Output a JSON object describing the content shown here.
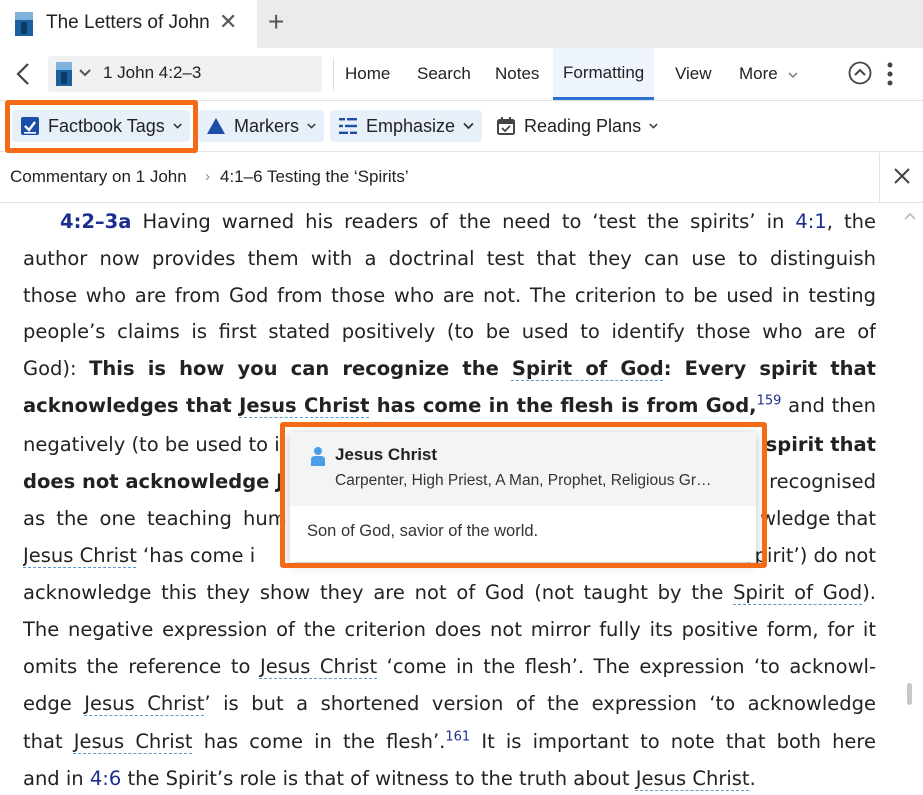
{
  "tab": {
    "title": "The Letters of John",
    "close": "✕",
    "add": "+"
  },
  "nav": {
    "reference": "1 John 4:2–3",
    "menu": [
      "Home",
      "Search",
      "Notes",
      "Formatting",
      "View",
      "More"
    ],
    "active_menu": "Formatting"
  },
  "ribbon": {
    "factbook_tags": "Factbook Tags",
    "markers": "Markers",
    "emphasize": "Emphasize",
    "reading_plans": "Reading Plans"
  },
  "breadcrumb": {
    "items": [
      "Commentary on 1 John",
      "4:1–6 Testing the ‘Spirits’"
    ],
    "separator": "›"
  },
  "article": {
    "verse_label": "4:2–3a",
    "p1": " Having warned his readers of the need to ‘test the spirits’ in ",
    "ref_4_1": "4:1",
    "p1b": ", the",
    "l2": "author now provides them with a doctrinal test that they can use to distinguish",
    "l3": "those who are from God from those who are not. The criterion to be used in testing",
    "l4": "people’s claims is first stated positively (to be used to identify those who are of",
    "l5a": "God): ",
    "l5b": "This is how you can recognize the ",
    "spirit_of_god": "Spirit of God",
    "l5c": ": Every spirit that",
    "l6a": "acknowledges that ",
    "jesus_christ": "Jesus Christ",
    "l6b": " has come in the flesh is from God,",
    "fn159": "159",
    "l6c": " and then",
    "l7a": "negatively (to be used to i",
    "l7b": "spirit that",
    "l8a": "does not acknowledge J",
    "l8b": "recognised",
    "l9a": "as the one teaching hum",
    "l9b": "wledge that",
    "l10b": " ‘has come i",
    "l10c": "spirit’) do not",
    "l11a": "acknowledge this they show they are not of God (not taught by the ",
    "l11b": ").",
    "l12": "The negative expression of the criterion does not mirror fully its positive form, for it",
    "l13a": "omits the reference to ",
    "l13b": " ‘come in the flesh’. The expression ‘to acknowl-",
    "l14a": "edge ",
    "l14b": "’ is but a shortened version of the expression ‘to acknowledge",
    "l15a": "that ",
    "l15b": " has come in the flesh’.",
    "fn161": "161",
    "l15c": " It is important to note that both here",
    "l16a": "and in ",
    "ref_4_6": "4:6",
    "l16b": " the Spirit’s role is that of witness to the truth about ",
    "l16c": "."
  },
  "popup": {
    "title": "Jesus Christ",
    "subtitle": "Carpenter, High Priest, A Man, Prophet, Religious Gr…",
    "description": "Son of God, savior of the world."
  },
  "colors": {
    "accent": "#2f6fd6",
    "highlight": "#f36b17",
    "link": "#1d2e8f"
  }
}
